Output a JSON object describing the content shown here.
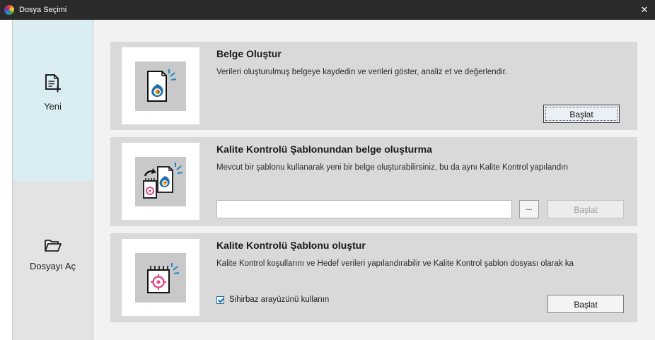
{
  "window": {
    "title": "Dosya Seçimi",
    "close_glyph": "✕"
  },
  "sidebar": {
    "items": [
      {
        "label": "Yeni",
        "icon": "new-document-icon",
        "selected": true
      },
      {
        "label": "Dosyayı Aç",
        "icon": "folder-open-icon",
        "selected": false
      }
    ]
  },
  "cards": [
    {
      "title": "Belge Oluştur",
      "description": "Verileri oluşturulmuş belgeye kaydedin ve verileri göster, analiz et ve değerlendir.",
      "button": "Başlat",
      "icon": "document-color-icon"
    },
    {
      "title": "Kalite Kontrolü Şablonundan belge oluşturma",
      "description": "Mevcut bir şablonu kullanarak yeni bir belge oluşturabilirsiniz, bu da aynı Kalite Kontrol yapılandırı",
      "path_value": "",
      "browse_label": "...",
      "button": "Başlat",
      "icon": "template-document-icon"
    },
    {
      "title": "Kalite Kontrolü Şablonu oluştur",
      "description": "Kalite Kontrol koşullarını ve Hedef verileri yapılandırabilir ve Kalite Kontrol şablon dosyası olarak ka",
      "checkbox_label": "Sihirbaz arayüzünü kullanın",
      "checkbox_checked": true,
      "button": "Başlat",
      "icon": "target-template-icon"
    }
  ],
  "colors": {
    "titlebar": "#2b2b2b",
    "sidebar_selected": "#d9edf3",
    "card_bg": "#d9d9d9",
    "accent": "#1f6fb2"
  }
}
